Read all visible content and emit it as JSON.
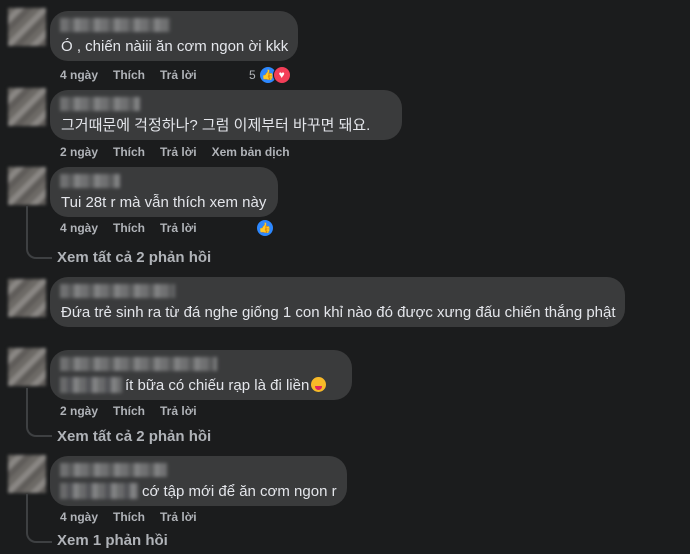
{
  "comments": [
    {
      "text": "Ó , chiến nàiii ăn cơm ngon ời kkk",
      "time": "4 ngày",
      "like": "Thích",
      "reply": "Trả lời",
      "reaction_count": "5"
    },
    {
      "text": "그거때문에 걱정하나? 그럼 이제부터 바꾸면 돼요.",
      "time": "2 ngày",
      "like": "Thích",
      "reply": "Trả lời",
      "translate": "Xem bản dịch"
    },
    {
      "text": "Tui 28t r mà vẫn thích xem này",
      "time": "4 ngày",
      "like": "Thích",
      "reply": "Trả lời",
      "replies": "Xem tất cả 2 phản hồi"
    },
    {
      "text": "Đứa trẻ sinh ra từ đá nghe giống 1 con khỉ nào đó được xưng đấu chiến thắng phật"
    },
    {
      "text": "ít bữa có chiếu rạp là đi liền",
      "time": "2 ngày",
      "like": "Thích",
      "reply": "Trả lời",
      "replies": "Xem tất cả 2 phản hồi"
    },
    {
      "text": "cớ tập mới để ăn cơm ngon r",
      "time": "4 ngày",
      "like": "Thích",
      "reply": "Trả lời",
      "replies": "Xem 1 phản hồi"
    }
  ],
  "icons": {
    "like": "like-icon",
    "love": "love-icon",
    "emoji": "tongue-emoji-icon"
  }
}
